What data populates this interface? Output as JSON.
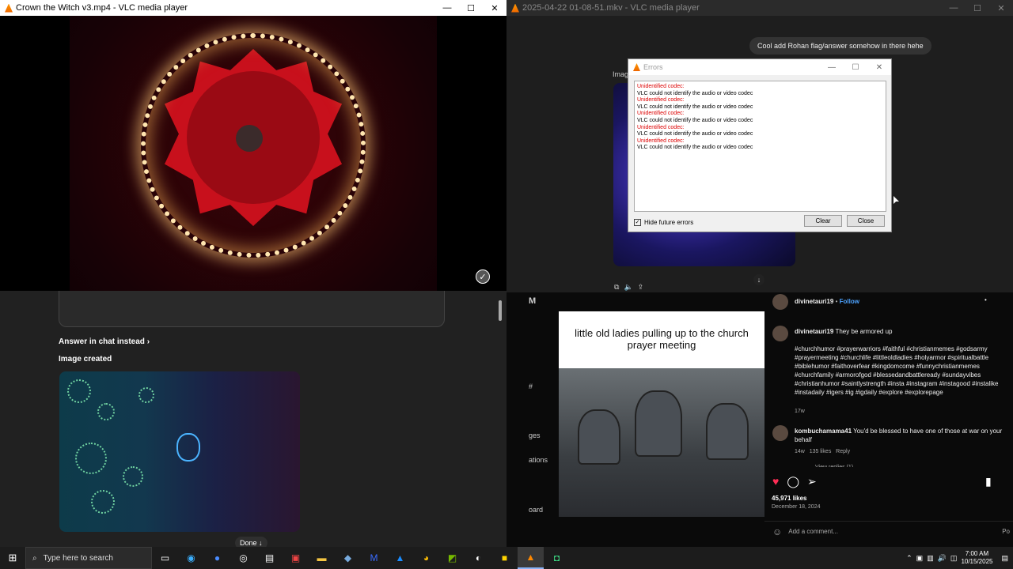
{
  "vlc1": {
    "title": "Crown the Witch v3.mp4 - VLC media player"
  },
  "vlc2": {
    "title": "2025-04-22 01-08-51.mkv - VLC media player",
    "chat_message": "Cool add Rohan flag/answer somehow in there hehe",
    "image_label": "Image"
  },
  "window_buttons": {
    "minimize": "—",
    "maximize": "☐",
    "close": "✕"
  },
  "errors_dialog": {
    "title": "Errors",
    "lines": [
      {
        "kind": "err",
        "text": "Unidentified codec:"
      },
      {
        "kind": "msg",
        "text": "VLC could not identify the audio or video codec"
      },
      {
        "kind": "err",
        "text": "Unidentified codec:"
      },
      {
        "kind": "msg",
        "text": "VLC could not identify the audio or video codec"
      },
      {
        "kind": "err",
        "text": "Unidentified codec:"
      },
      {
        "kind": "msg",
        "text": "VLC could not identify the audio or video codec"
      },
      {
        "kind": "err",
        "text": "Unidentified codec:"
      },
      {
        "kind": "msg",
        "text": "VLC could not identify the audio or video codec"
      },
      {
        "kind": "err",
        "text": "Unidentified codec:"
      },
      {
        "kind": "msg",
        "text": "VLC could not identify the audio or video codec"
      }
    ],
    "hide_future_label": "Hide future errors",
    "hide_future_checked": true,
    "clear_label": "Clear",
    "close_label": "Close"
  },
  "chat": {
    "answer_link": "Answer in chat instead ›",
    "image_created": "Image created",
    "done_button": "Done ↓"
  },
  "instagram": {
    "left_labels": [
      "M",
      "#",
      "ges",
      "ations",
      "oard"
    ],
    "caption_image_text": "little old ladies pulling up to the church prayer meeting",
    "header_user": "divinetauri19",
    "follow": "Follow",
    "more": "•",
    "post_user": "divinetauri19",
    "post_text": "They be armored up",
    "hashtags": "#churchhumor #prayerwarriors #faithful #christianmemes #godsarmy #prayermeeting #churchlife #littleoldladies #holyarmor #spiritualbattle #biblehumor #faithoverfear #kingdomcome #funnychristianmemes #churchfamily #armorofgod #blessedandbattleready #sundayvibes #christianhumor #saintlystrength #insta #instagram #instagood #instalike #instadaily #igers #ig #igdaily #explore #explorepage",
    "post_age": "17w",
    "comment_user": "kombuchamama41",
    "comment_text": "You'd be blessed to have one of those at war on your behalf",
    "comment_age": "14w",
    "comment_likes": "135 likes",
    "comment_reply": "Reply",
    "view_replies": "View replies (1)",
    "likes": "45,971 likes",
    "date": "December 18, 2024",
    "add_comment": "Add a comment...",
    "post_button": "Po"
  },
  "taskbar": {
    "search_placeholder": "Type here to search",
    "time": "7:00 AM",
    "date": "10/15/2025"
  },
  "colors": {
    "vlc_orange": "#ff8800",
    "error_red": "#dd0000",
    "ig_blue": "#4da3ff",
    "heart": "#ff2d55"
  }
}
